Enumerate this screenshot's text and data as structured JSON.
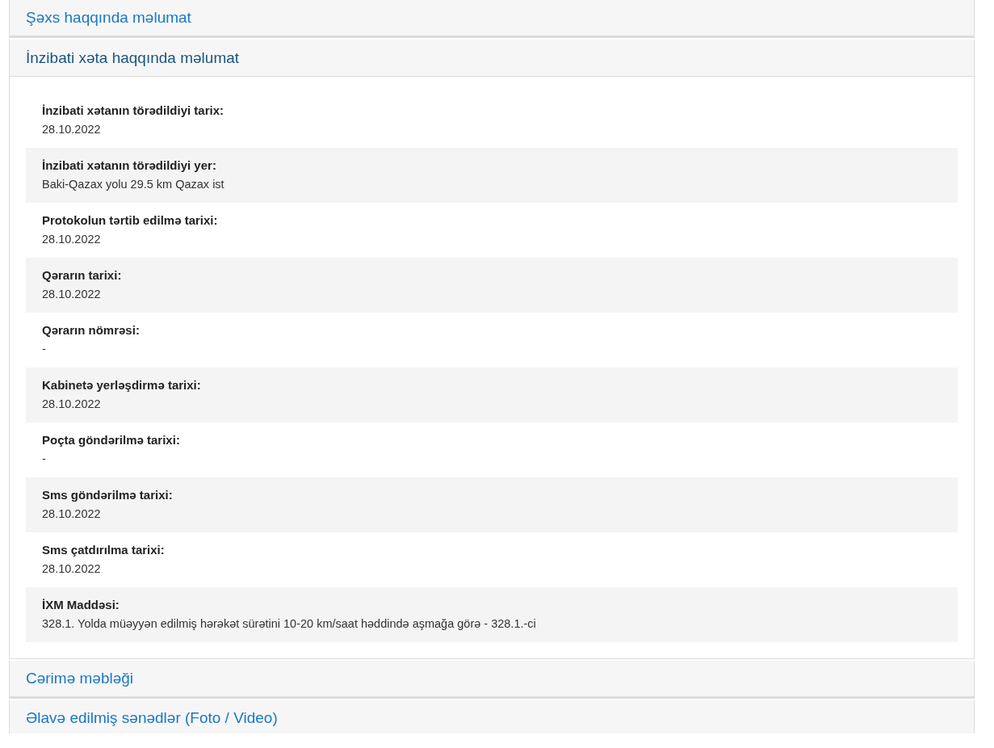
{
  "panels": [
    {
      "title": "Şəxs haqqında məlumat",
      "expanded": false
    },
    {
      "title": "İnzibati xəta haqqında məlumat",
      "expanded": true,
      "fields": [
        {
          "label": "İnzibati xətanın törədildiyi tarix:",
          "value": "28.10.2022"
        },
        {
          "label": "İnzibati xətanın törədildiyi yer:",
          "value": "Baki-Qazax yolu 29.5 km Qazax ist"
        },
        {
          "label": "Protokolun tərtib edilmə tarixi:",
          "value": "28.10.2022"
        },
        {
          "label": "Qərarın tarixi:",
          "value": "28.10.2022"
        },
        {
          "label": "Qərarın nömrəsi:",
          "value": "-"
        },
        {
          "label": "Kabinetə yerləşdirmə tarixi:",
          "value": "28.10.2022"
        },
        {
          "label": "Poçta göndərilmə tarixi:",
          "value": "-"
        },
        {
          "label": "Sms göndərilmə tarixi:",
          "value": "28.10.2022"
        },
        {
          "label": "Sms çatdırılma tarixi:",
          "value": "28.10.2022"
        },
        {
          "label": "İXM Maddəsi:",
          "value": "328.1. Yolda müəyyən edilmiş hərəkət sürətini 10-20 km/saat həddində aşmağa görə - 328.1.-ci"
        }
      ]
    },
    {
      "title": "Cərimə məbləği",
      "expanded": false
    },
    {
      "title": "Əlavə edilmiş sənədlər (Foto / Video)",
      "expanded": false
    }
  ]
}
